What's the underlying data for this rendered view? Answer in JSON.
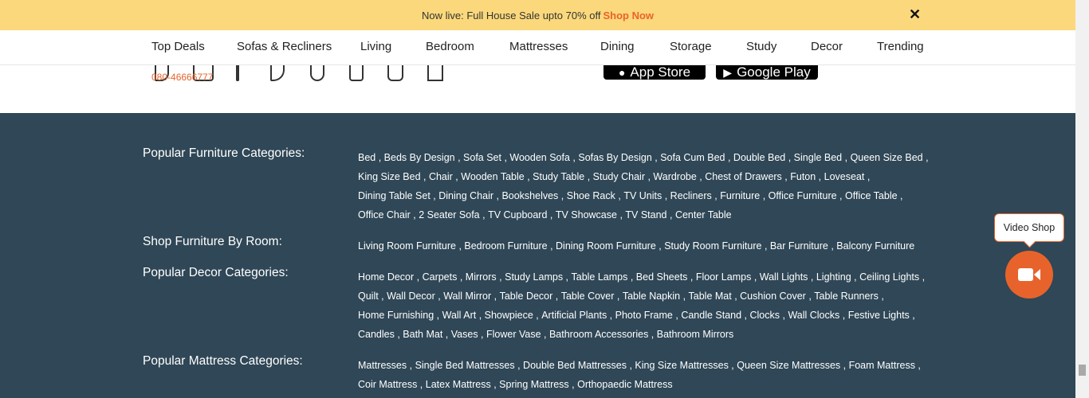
{
  "banner": {
    "text": "Now live: Full House Sale upto 70% off",
    "cta": "Shop Now",
    "close_glyph": "✕"
  },
  "nav": {
    "items": [
      "Top Deals",
      "Sofas & Recliners",
      "Living",
      "Bedroom",
      "Mattresses",
      "Dining",
      "Storage",
      "Study",
      "Decor",
      "Trending"
    ]
  },
  "contact": {
    "phone": "080-46666777",
    "social_icons": [
      "phone-icon",
      "mail-icon",
      "facebook-icon",
      "twitter-icon",
      "pinterest-icon",
      "youtube-icon",
      "instagram-icon",
      "linkedin-icon"
    ],
    "app_store": "App Store",
    "google_play": "Google Play"
  },
  "footer": {
    "rows": [
      {
        "title": "Popular Furniture Categories:",
        "links": [
          "Bed",
          "Beds By Design",
          "Sofa Set",
          "Wooden Sofa",
          "Sofas By Design",
          "Sofa Cum Bed",
          "Double Bed",
          "Single Bed",
          "Queen Size Bed",
          "King Size Bed",
          "Chair",
          "Wooden Table",
          "Study Table",
          "Study Chair",
          "Wardrobe",
          "Chest of Drawers",
          "Futon",
          "Loveseat",
          "Dining Table Set",
          "Dining Chair",
          "Bookshelves",
          "Shoe Rack",
          "TV Units",
          "Recliners",
          "Furniture",
          "Office Furniture",
          "Office Table",
          "Office Chair",
          "2 Seater Sofa",
          "TV Cupboard",
          "TV Showcase",
          "TV Stand",
          "Center Table"
        ]
      },
      {
        "title": "Shop Furniture By Room:",
        "links": [
          "Living Room Furniture",
          "Bedroom Furniture",
          "Dining Room Furniture",
          "Study Room Furniture",
          "Bar Furniture",
          "Balcony Furniture"
        ]
      },
      {
        "title": "Popular Decor Categories:",
        "links": [
          "Home Decor",
          "Carpets",
          "Mirrors",
          "Study Lamps",
          "Table Lamps",
          "Bed Sheets",
          "Floor Lamps",
          "Wall Lights",
          "Lighting",
          "Ceiling Lights",
          "Quilt",
          "Wall Decor",
          "Wall Mirror",
          "Table Decor",
          "Table Cover",
          "Table Napkin",
          "Table Mat",
          "Cushion Cover",
          "Table Runners",
          "Home Furnishing",
          "Wall Art",
          "Showpiece",
          "Artificial Plants",
          "Photo Frame",
          "Candle Stand",
          "Clocks",
          "Wall Clocks",
          "Festive Lights",
          "Candles",
          "Bath Mat",
          "Vases",
          "Flower Vase",
          "Bathroom Accessories",
          "Bathroom Mirrors"
        ]
      },
      {
        "title": "Popular Mattress Categories:",
        "links": [
          "Mattresses",
          "Single Bed Mattresses",
          "Double Bed Mattresses",
          "King Size Mattresses",
          "Queen Size Mattresses",
          "Foam Mattress",
          "Coir Mattress",
          "Latex Mattress",
          "Spring Mattress",
          "Orthopaedic Mattress"
        ]
      }
    ]
  },
  "video_shop": {
    "label": "Video Shop",
    "icon": "video-camera-icon"
  },
  "colors": {
    "banner_bg": "#fbd87b",
    "accent": "#e8632b",
    "footer_bg": "#2f4756"
  }
}
